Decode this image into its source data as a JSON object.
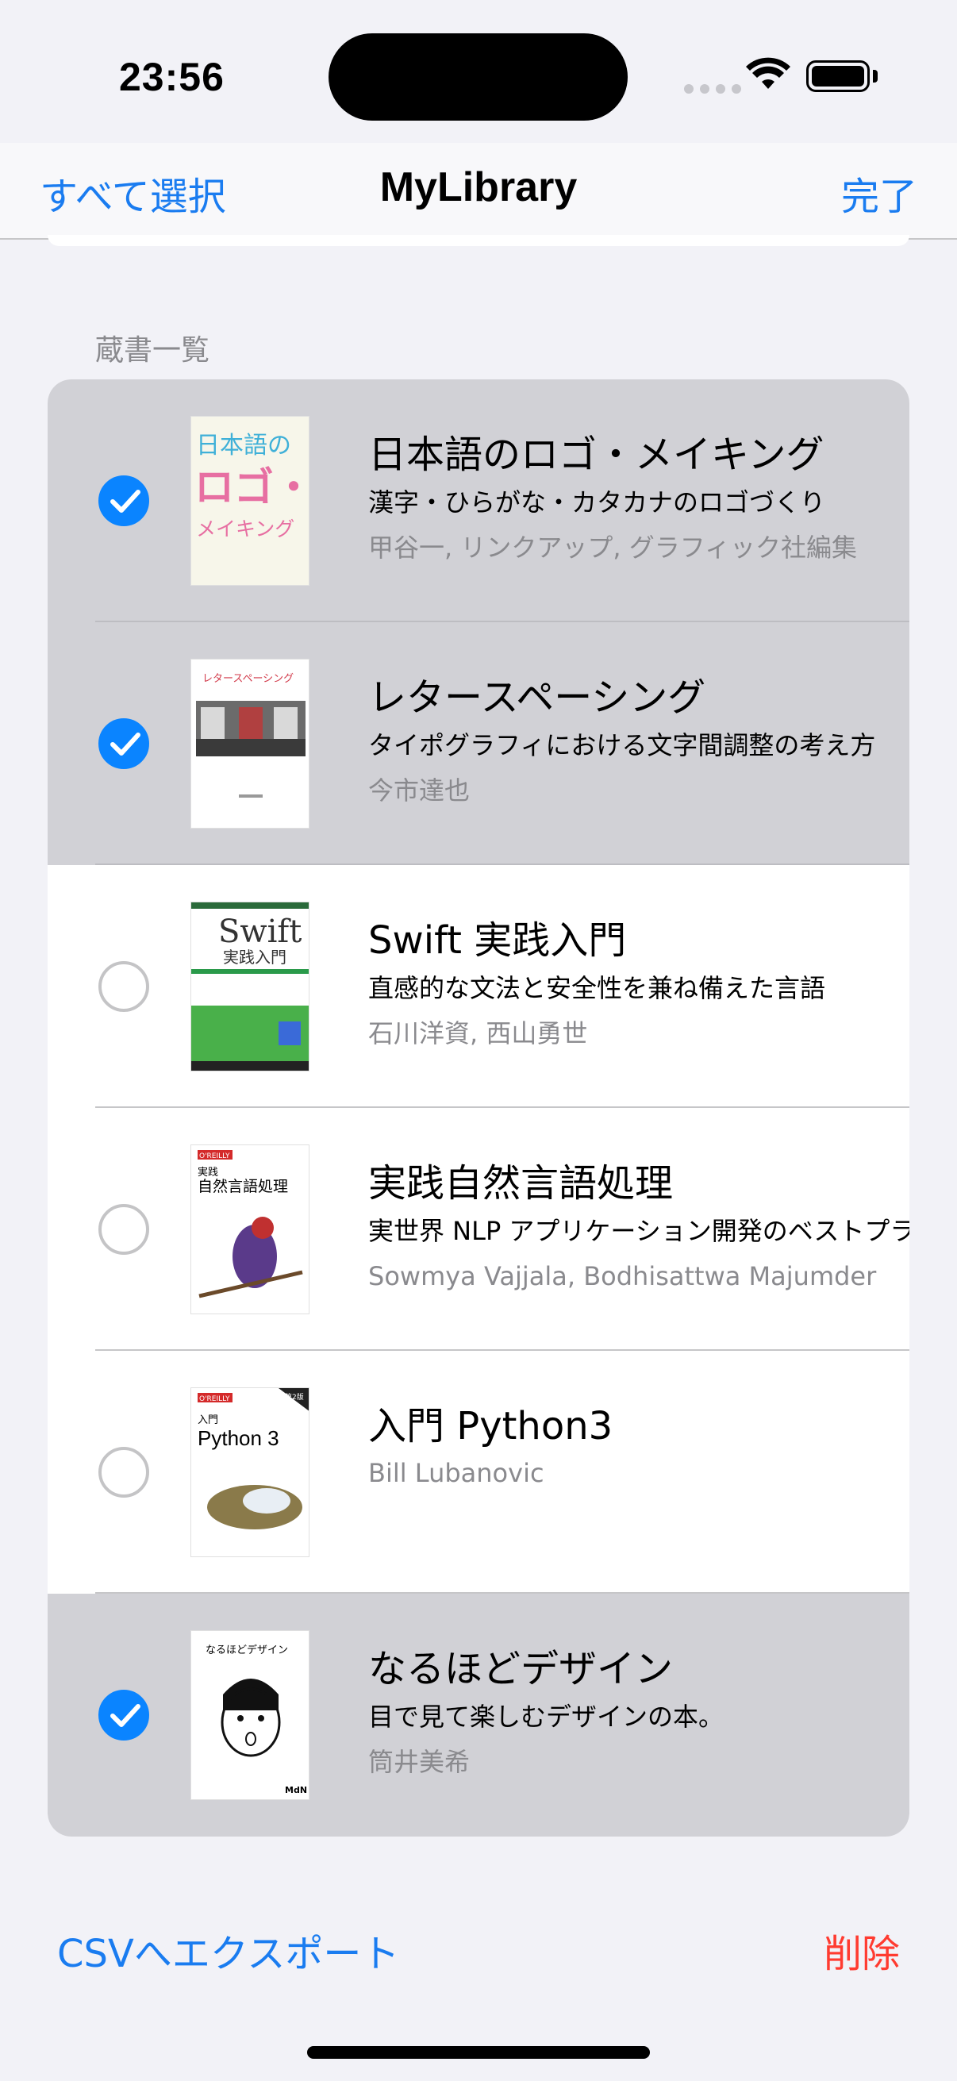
{
  "status_bar": {
    "time": "23:56"
  },
  "nav": {
    "left_label": "すべて選択",
    "title": "MyLibrary",
    "right_label": "完了"
  },
  "section_header": "蔵書一覧",
  "books": [
    {
      "title": "日本語のロゴ・メイキング",
      "subtitle": "漢字・ひらがな・カタカナのロゴづくり",
      "author": "甲谷一, リンクアップ, グラフィック社編集",
      "selected": true,
      "cover_text_1": "日本語の",
      "cover_text_2": "ロゴ・",
      "cover_text_3": "メイキング"
    },
    {
      "title": "レタースペーシング",
      "subtitle": "タイポグラフィにおける文字間調整の考え方",
      "author": "今市達也",
      "selected": true,
      "cover_text_1": "レタースペーシング"
    },
    {
      "title": "Swift 実践入門",
      "subtitle": "直感的な文法と安全性を兼ね備えた言語",
      "author": "石川洋資, 西山勇世",
      "selected": false,
      "cover_text_1": "Swift",
      "cover_text_2": "実践入門"
    },
    {
      "title": "実践自然言語処理",
      "subtitle": "実世界 NLP アプリケーション開発のベストプラクティス",
      "author": "Sowmya Vajjala, Bodhisattwa Majumder",
      "selected": false,
      "cover_text_1": "O'REILLY",
      "cover_text_2": "実践",
      "cover_text_3": "自然言語処理"
    },
    {
      "title": "入門 Python3",
      "subtitle": "",
      "author": "Bill Lubanovic",
      "selected": false,
      "cover_text_1": "O'REILLY",
      "cover_text_2": "入門",
      "cover_text_3": "Python 3",
      "cover_badge": "第2版"
    },
    {
      "title": "なるほどデザイン",
      "subtitle": "目で見て楽しむデザインの本。",
      "author": "筒井美希",
      "selected": true,
      "cover_text_1": "なるほどデザイン",
      "cover_text_2": "MdN"
    }
  ],
  "toolbar": {
    "export_label": "CSVへエクスポート",
    "delete_label": "削除"
  },
  "colors": {
    "accent": "#1a7cf0",
    "destructive": "#ff3b30",
    "selected_row": "#d1d1d6",
    "check_on": "#0a84ff"
  }
}
